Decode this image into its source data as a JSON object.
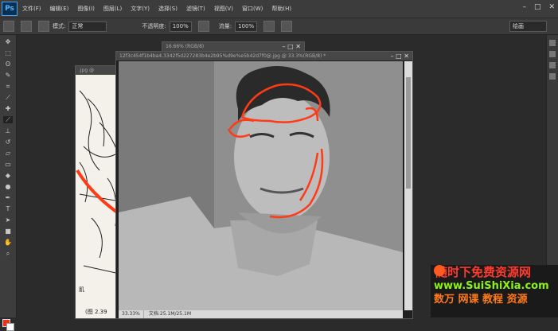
{
  "app": {
    "logo": "Ps"
  },
  "menu": [
    "文件(F)",
    "编辑(E)",
    "图像(I)",
    "图层(L)",
    "文字(Y)",
    "选择(S)",
    "滤镜(T)",
    "视图(V)",
    "窗口(W)",
    "帮助(H)"
  ],
  "window_controls": [
    "–",
    "□",
    "✕"
  ],
  "options": {
    "mode_label": "模式:",
    "mode_value": "正常",
    "opacity_label": "不透明度:",
    "opacity_value": "100%",
    "flow_label": "流量:",
    "flow_value": "100%",
    "workspace": "绘画"
  },
  "documents": {
    "sketch_title": ".jpg @",
    "back_title": "16.66% (RGB/8)",
    "main_title": "12f3c454f1b4ba4.3342f5d227283b4e2b95%d9e%e5b42d7f0@.jpg @ 33.3%(RGB/8) *",
    "main_zoom": "33.33%",
    "main_doc_info": "文档:25.1M/25.1M"
  },
  "sketch_text": {
    "label": "肌",
    "caption": "(图 2.39"
  },
  "watermark": {
    "line1": "随时下免费资源网",
    "line2": "www.SuiShiXia.com",
    "line3": "数万 网课 教程 资源"
  },
  "colors": {
    "stroke": "#ff3a14",
    "accent": "#3fa7ff",
    "foreground": "#e8331c",
    "background": "#ffffff"
  },
  "icons": [
    "move-icon",
    "marquee-icon",
    "lasso-icon",
    "quick-select-icon",
    "crop-icon",
    "eyedropper-icon",
    "healing-icon",
    "brush-icon",
    "clone-stamp-icon",
    "history-brush-icon",
    "eraser-icon",
    "gradient-icon",
    "blur-icon",
    "dodge-icon",
    "pen-icon",
    "type-icon",
    "path-select-icon",
    "shape-icon",
    "hand-icon",
    "zoom-icon"
  ]
}
